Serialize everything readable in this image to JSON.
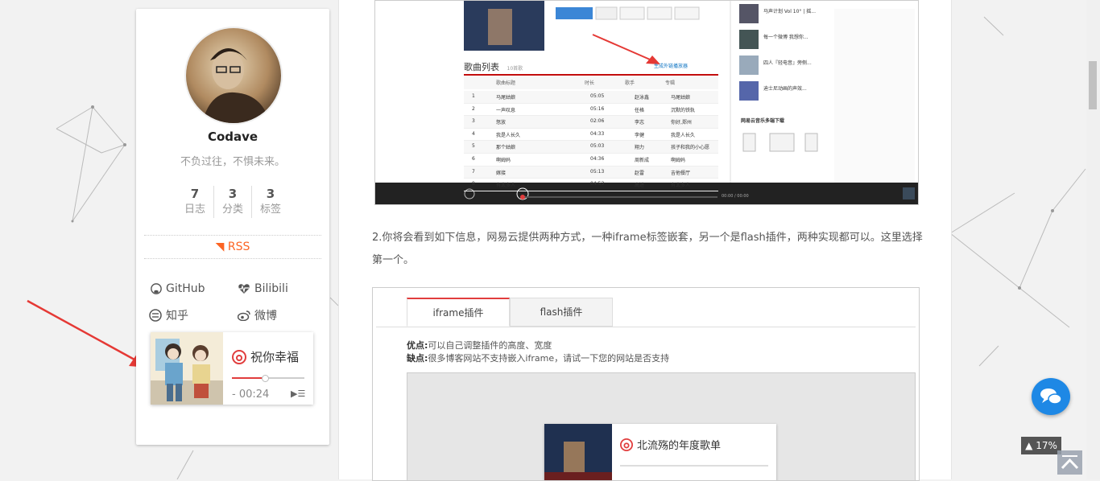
{
  "sidebar": {
    "author": "Codave",
    "motto": "不负过往，不惧未来。",
    "stats": [
      {
        "value": "7",
        "label": "日志"
      },
      {
        "value": "3",
        "label": "分类"
      },
      {
        "value": "3",
        "label": "标签"
      }
    ],
    "rss": "RSS",
    "links": [
      {
        "label": "GitHub",
        "icon": "github-icon"
      },
      {
        "label": "Bilibili",
        "icon": "heartbeat-icon"
      },
      {
        "label": "知乎",
        "icon": "zhihu-icon"
      },
      {
        "label": "微博",
        "icon": "weibo-icon"
      }
    ]
  },
  "player": {
    "song": "祝你幸福",
    "time": "- 00:24",
    "progress": 0.45,
    "accent": "#e13d3d"
  },
  "article": {
    "paragraph": "2.你将会看到如下信息，网易云提供两种方式，一种iframe标签嵌套，另一个是flash插件，两种实现都可以。这里选择第一个。",
    "screenshot1": {
      "section": "歌曲列表",
      "count": "10首歌",
      "link": "生成外链播放器",
      "cols": [
        "歌曲标题",
        "时长",
        "歌手",
        "专辑"
      ],
      "rows": [
        [
          "1",
          "马尾姑娘",
          "05:05",
          "赵泳鑫",
          "马尾姑娘"
        ],
        [
          "2",
          "一声叹息",
          "05:16",
          "任格",
          "沉默的铁轨"
        ],
        [
          "3",
          "怒放",
          "02:06",
          "李志",
          "你好,郑州"
        ],
        [
          "4",
          "我是人长久",
          "04:33",
          "李健",
          "我是人长久"
        ],
        [
          "5",
          "那个姑娘",
          "05:03",
          "翔力",
          "孩子和我的小心愿"
        ],
        [
          "6",
          "啊姆妈",
          "04:36",
          "周新成",
          "啊姆妈"
        ],
        [
          "7",
          "嫁接",
          "05:13",
          "赵雷",
          "吉他餐厅"
        ],
        [
          "8",
          "有太多人",
          "04:53",
          "高进",
          "有太多人"
        ]
      ],
      "side_items": [
        "马声计划 Vol 10° | 摇...",
        "每一个微博 我想你...",
        "四人『轻电音』旁侧...",
        "迪士尼动画的声效..."
      ],
      "side_heading": "网易云音乐多端下载",
      "player_time": "00:00 / 00:00"
    },
    "tabs": [
      "iframe插件",
      "flash插件"
    ],
    "pros_label": "优点:",
    "pros": "可以自己调整插件的高度、宽度",
    "cons_label": "缺点:",
    "cons": "很多博客网站不支持嵌入iframe，请试一下您的网站是否支持",
    "embed_title": "北流殇的年度歌单"
  },
  "widgets": {
    "scroll_percent": "17%"
  }
}
